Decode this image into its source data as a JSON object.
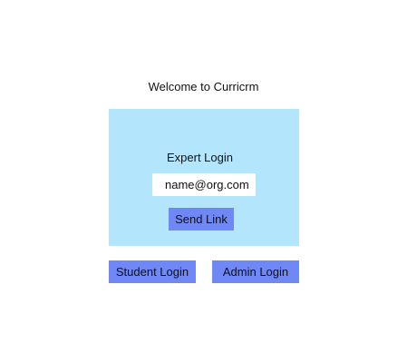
{
  "header": {
    "welcome_text": "Welcome to Curricrm"
  },
  "expert_login": {
    "title": "Expert Login",
    "email_value": "name@org.com",
    "send_link_label": "Send Link"
  },
  "alt_logins": {
    "student_label": "Student Login",
    "admin_label": "Admin Login"
  },
  "colors": {
    "panel_background": "#b3e6fd",
    "button_background": "#6f88f6",
    "input_background": "#ffffff"
  }
}
